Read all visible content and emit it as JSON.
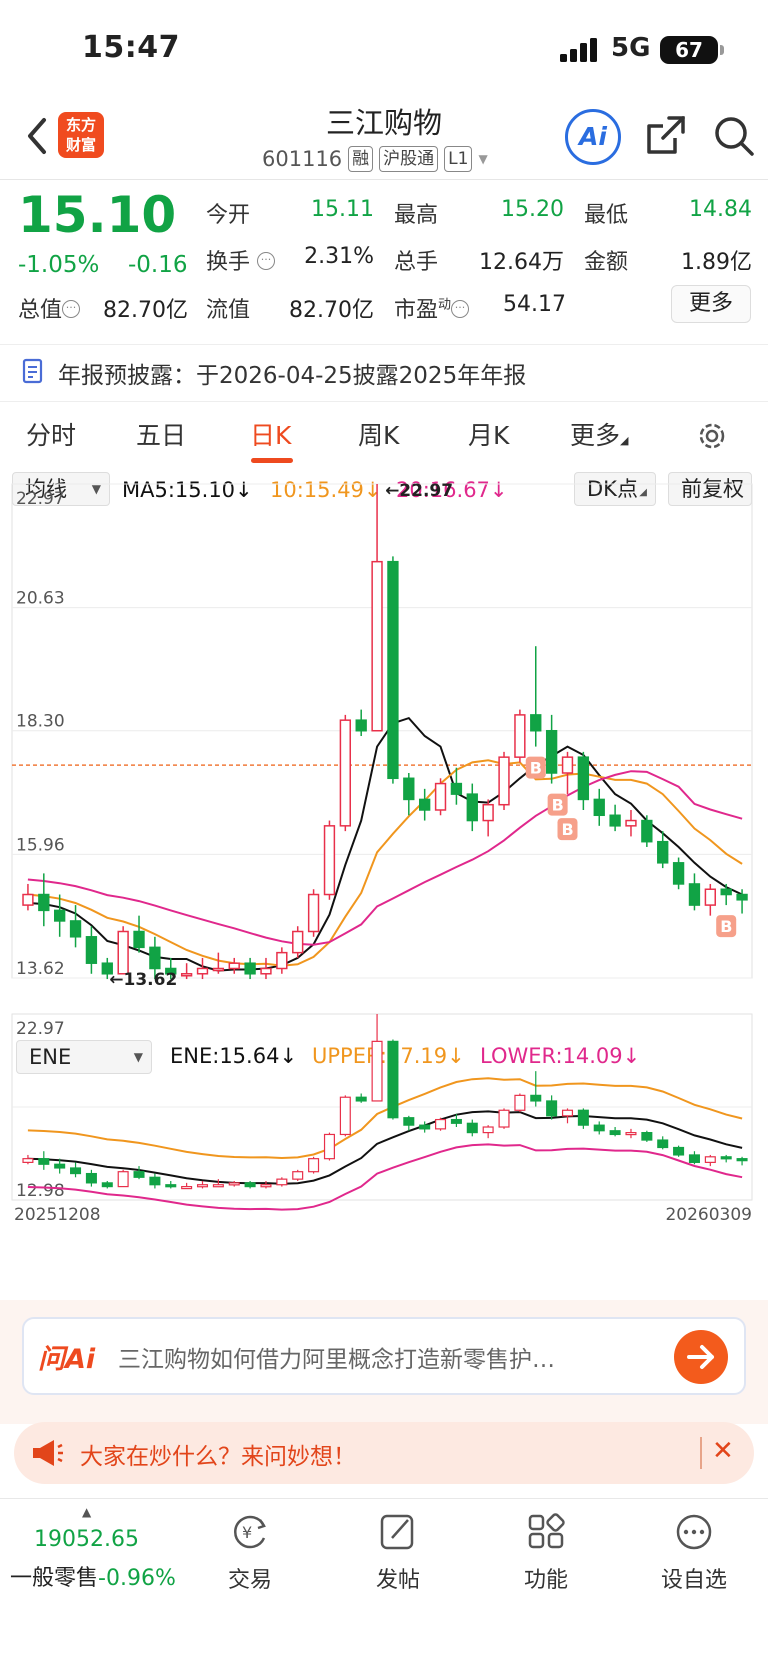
{
  "status": {
    "time": "15:47",
    "network": "5G",
    "battery": "67"
  },
  "header": {
    "stock_name": "三江购物",
    "code": "601116",
    "tags": [
      "融",
      "沪股通",
      "L1"
    ],
    "ai_label": "Ai"
  },
  "quote": {
    "price": "15.10",
    "change_pct": "-1.05%",
    "change_abs": "-0.16",
    "fields": {
      "open_label": "今开",
      "open": "15.11",
      "high_label": "最高",
      "high": "15.20",
      "low_label": "最低",
      "low": "14.84",
      "turnover_label": "换手",
      "turnover": "2.31%",
      "volume_label": "总手",
      "volume": "12.64万",
      "amount_label": "金额",
      "amount": "1.89亿",
      "mcap_label": "总值",
      "mcap": "82.70亿",
      "float_label": "流值",
      "float": "82.70亿",
      "pe_label": "市盈",
      "pe_sup": "动",
      "pe": "54.17"
    },
    "more_label": "更多"
  },
  "notice": {
    "text": "年报预披露：于2026-04-25披露2025年年报"
  },
  "tabs": [
    {
      "label": "分时"
    },
    {
      "label": "五日"
    },
    {
      "label": "日K"
    },
    {
      "label": "周K"
    },
    {
      "label": "月K"
    },
    {
      "label": "更多"
    }
  ],
  "indicators": {
    "ma_select": "均线",
    "ma5": "MA5:15.10↓",
    "ma10": "10:15.49↓",
    "ma20": "20:16.67↓",
    "dk_label": "DK点",
    "adjust_label": "前复权",
    "ene_select": "ENE",
    "ene": "ENE:15.64↓",
    "upper": "UPPER:17.19↓",
    "lower": "LOWER:14.09↓"
  },
  "colors": {
    "up": "#e8304a",
    "down": "#11a345",
    "ma5": "#111111",
    "ma10": "#f0961e",
    "ma20": "#e0288c",
    "accent": "#ee4a1f"
  },
  "chart_data": [
    {
      "type": "candlestick",
      "title": "",
      "y_ticks": [
        "22.97",
        "20.63",
        "18.30",
        "15.96",
        "13.62"
      ],
      "ylim": [
        13.62,
        22.97
      ],
      "annotations": {
        "max": "22.97",
        "min": "13.62",
        "signal_markers": [
          "B",
          "B",
          "B",
          "B"
        ]
      },
      "current_price_line": 17.65,
      "candles": [
        [
          15.0,
          15.4,
          14.9,
          15.2
        ],
        [
          15.2,
          15.6,
          14.6,
          14.9
        ],
        [
          14.9,
          15.2,
          14.4,
          14.7
        ],
        [
          14.7,
          15.0,
          14.2,
          14.4
        ],
        [
          14.4,
          14.6,
          13.7,
          13.9
        ],
        [
          13.9,
          14.0,
          13.6,
          13.7
        ],
        [
          13.7,
          14.6,
          13.7,
          14.5
        ],
        [
          14.5,
          14.8,
          14.1,
          14.2
        ],
        [
          14.2,
          14.4,
          13.6,
          13.8
        ],
        [
          13.8,
          14.0,
          13.6,
          13.7
        ],
        [
          13.7,
          13.9,
          13.6,
          13.7
        ],
        [
          13.7,
          14.0,
          13.6,
          13.8
        ],
        [
          13.8,
          14.1,
          13.7,
          13.8
        ],
        [
          13.8,
          14.0,
          13.7,
          13.9
        ],
        [
          13.9,
          14.0,
          13.6,
          13.7
        ],
        [
          13.7,
          14.0,
          13.6,
          13.8
        ],
        [
          13.8,
          14.2,
          13.7,
          14.1
        ],
        [
          14.1,
          14.6,
          14.0,
          14.5
        ],
        [
          14.5,
          15.3,
          14.4,
          15.2
        ],
        [
          15.2,
          16.6,
          15.1,
          16.5
        ],
        [
          16.5,
          18.6,
          16.4,
          18.5
        ],
        [
          18.5,
          18.7,
          18.2,
          18.3
        ],
        [
          18.3,
          22.97,
          19.8,
          21.5
        ],
        [
          21.5,
          21.6,
          17.3,
          17.4
        ],
        [
          17.4,
          17.5,
          16.7,
          17.0
        ],
        [
          17.0,
          17.2,
          16.6,
          16.8
        ],
        [
          16.8,
          17.4,
          16.7,
          17.3
        ],
        [
          17.3,
          17.6,
          16.9,
          17.1
        ],
        [
          17.1,
          17.3,
          16.4,
          16.6
        ],
        [
          16.6,
          17.0,
          16.3,
          16.9
        ],
        [
          16.9,
          17.9,
          16.8,
          17.8
        ],
        [
          17.8,
          18.7,
          17.7,
          18.6
        ],
        [
          18.6,
          19.9,
          18.0,
          18.3
        ],
        [
          18.3,
          18.6,
          17.3,
          17.5
        ],
        [
          17.5,
          17.9,
          17.1,
          17.8
        ],
        [
          17.8,
          17.9,
          16.8,
          17.0
        ],
        [
          17.0,
          17.2,
          16.5,
          16.7
        ],
        [
          16.7,
          16.9,
          16.4,
          16.5
        ],
        [
          16.5,
          16.8,
          16.3,
          16.6
        ],
        [
          16.6,
          16.7,
          16.1,
          16.2
        ],
        [
          16.2,
          16.4,
          15.7,
          15.8
        ],
        [
          15.8,
          15.9,
          15.3,
          15.4
        ],
        [
          15.4,
          15.6,
          14.9,
          15.0
        ],
        [
          15.0,
          15.4,
          14.8,
          15.3
        ],
        [
          15.3,
          15.4,
          15.0,
          15.2
        ],
        [
          15.2,
          15.3,
          14.84,
          15.1
        ]
      ]
    },
    {
      "type": "ene",
      "y_ticks": [
        "22.97",
        "12.98"
      ],
      "ylim": [
        12.98,
        22.97
      ],
      "date_start": "20251208",
      "date_end": "20260309"
    }
  ],
  "ask": {
    "logo": "问Ai",
    "text": "三江购物如何借力阿里概念打造新零售护…"
  },
  "hot": {
    "text": "大家在炒什么？来问妙想！"
  },
  "bottom": {
    "index_value": "19052.65",
    "index_name": "一般零售",
    "index_change": "-0.96%",
    "nav": [
      {
        "label": "交易"
      },
      {
        "label": "发帖"
      },
      {
        "label": "功能"
      },
      {
        "label": "设自选"
      }
    ]
  }
}
